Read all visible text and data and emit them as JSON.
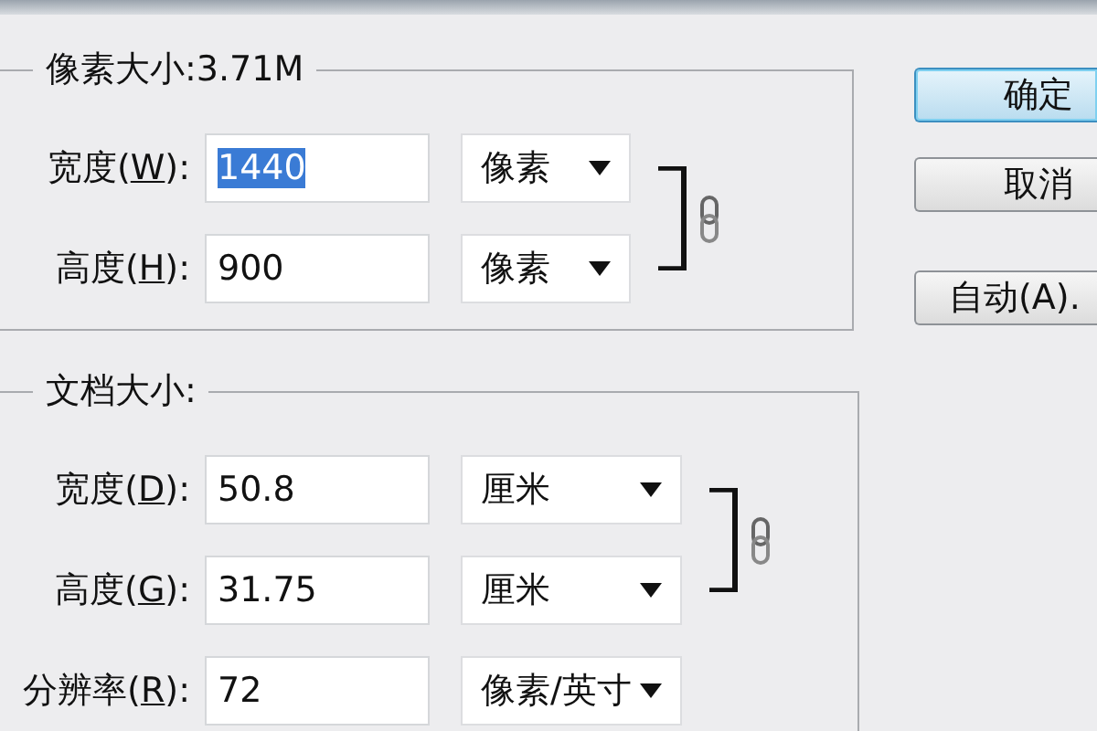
{
  "groups": [
    {
      "title": "像素大小:3.71M",
      "rows": [
        {
          "label_before": "宽度(",
          "mnemonic": "W",
          "label_after": "):",
          "value": "1440",
          "text_selected": true,
          "unit": "像素",
          "linked": true
        },
        {
          "label_before": "高度(",
          "mnemonic": "H",
          "label_after": "):",
          "value": "900",
          "text_selected": false,
          "unit": "像素",
          "linked": true
        }
      ]
    },
    {
      "title": "文档大小:",
      "rows": [
        {
          "label_before": "宽度(",
          "mnemonic": "D",
          "label_after": "):",
          "value": "50.8",
          "text_selected": false,
          "unit": "厘米",
          "linked": true
        },
        {
          "label_before": "高度(",
          "mnemonic": "G",
          "label_after": "):",
          "value": "31.75",
          "text_selected": false,
          "unit": "厘米",
          "linked": true
        },
        {
          "label_before": "分辨率(",
          "mnemonic": "R",
          "label_after": "):",
          "value": "72",
          "text_selected": false,
          "unit": "像素/英寸",
          "linked": false
        }
      ]
    }
  ],
  "buttons": [
    {
      "label": "确定",
      "default": true
    },
    {
      "label": "取消",
      "default": false
    },
    {
      "label": "自动(A).",
      "default": false
    }
  ]
}
